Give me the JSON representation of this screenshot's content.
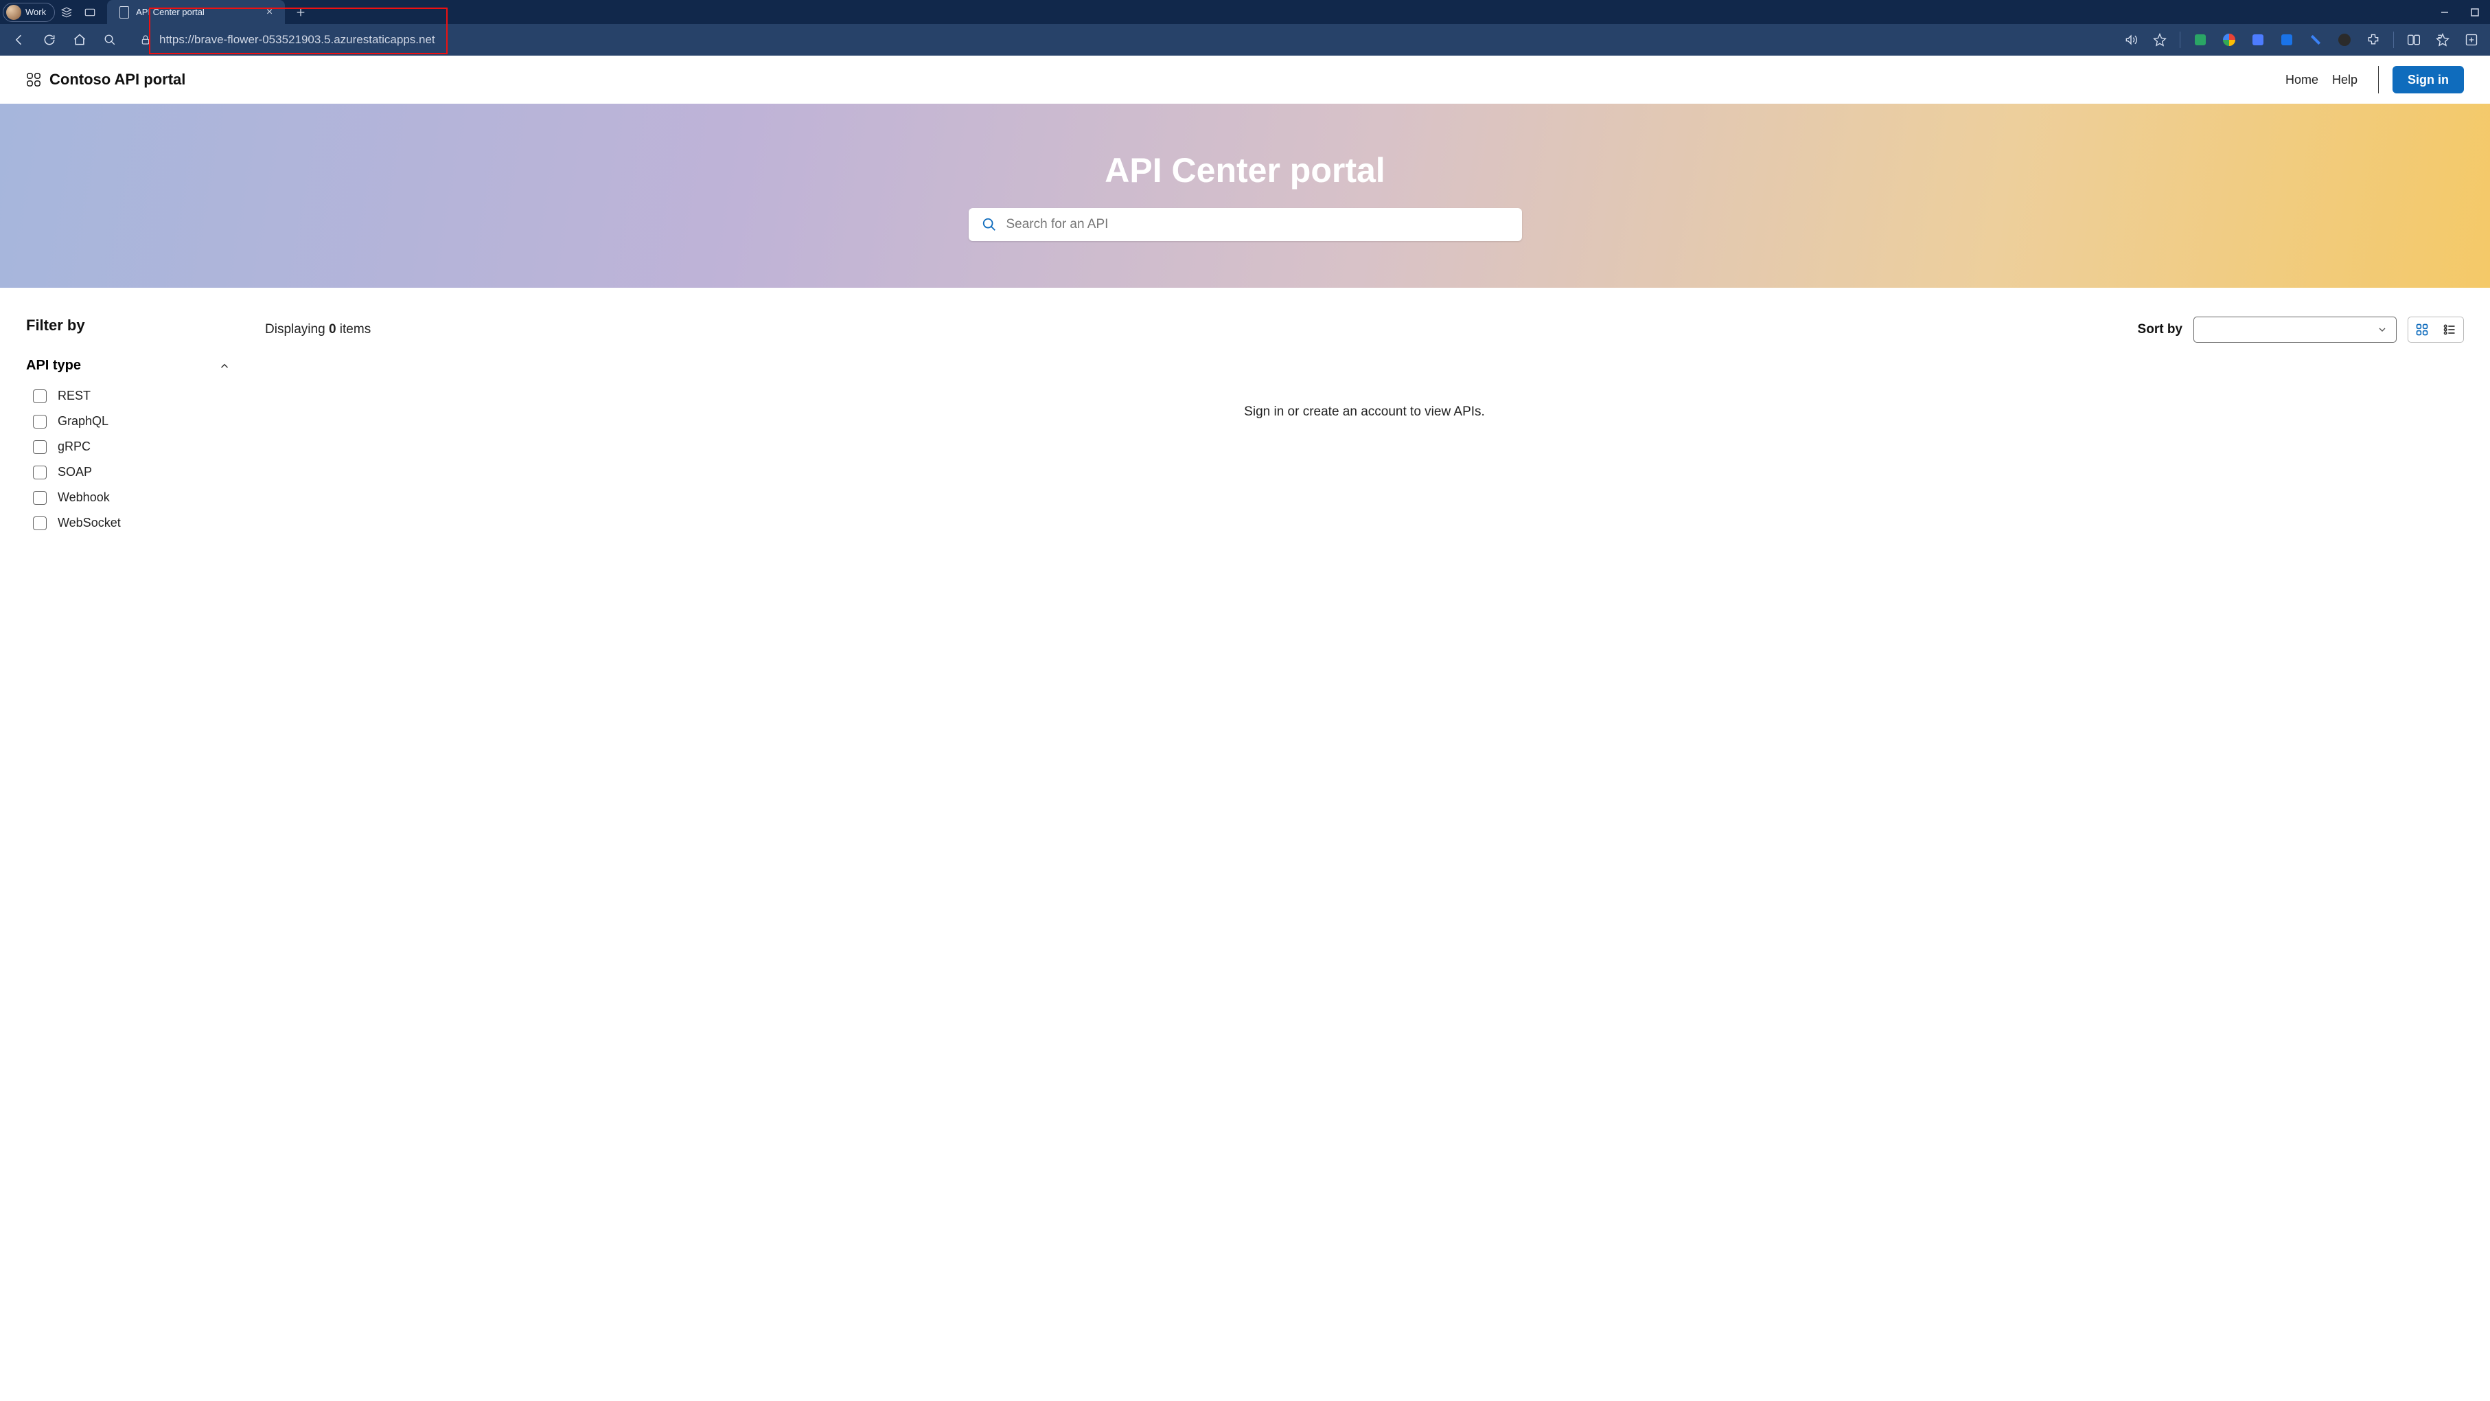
{
  "browser": {
    "profile_label": "Work",
    "tab_title": "API Center portal",
    "url": "https://brave-flower-053521903.5.azurestaticapps.net"
  },
  "header": {
    "brand": "Contoso API portal",
    "nav_home": "Home",
    "nav_help": "Help",
    "signin": "Sign in"
  },
  "hero": {
    "title": "API Center portal",
    "search_placeholder": "Search for an API"
  },
  "filter": {
    "title": "Filter by",
    "group_label": "API type",
    "options": [
      "REST",
      "GraphQL",
      "gRPC",
      "SOAP",
      "Webhook",
      "WebSocket"
    ]
  },
  "list": {
    "displaying_prefix": "Displaying ",
    "count": "0",
    "displaying_suffix": " items",
    "sort_label": "Sort by",
    "empty_message": "Sign in or create an account to view APIs."
  }
}
